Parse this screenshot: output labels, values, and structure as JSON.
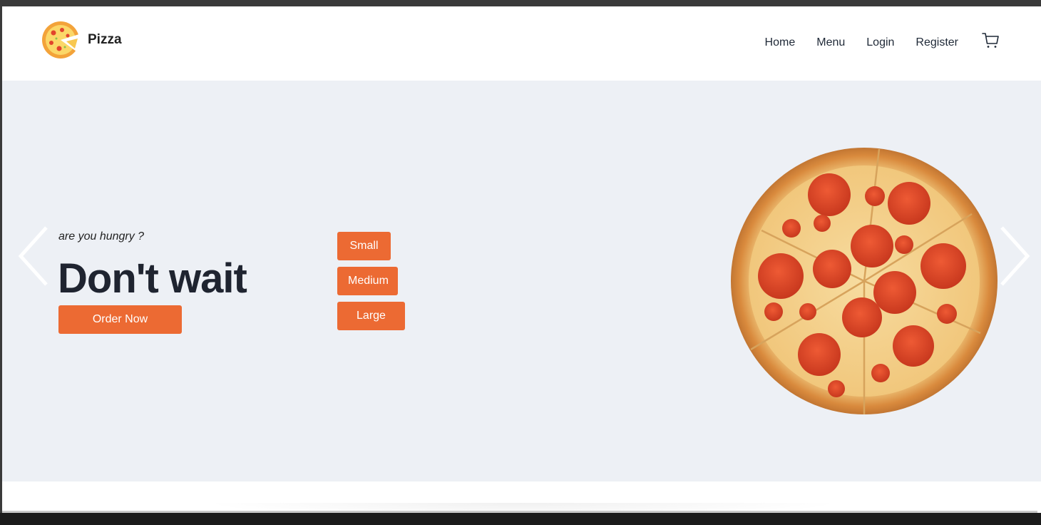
{
  "header": {
    "brand": "Pizza",
    "logo_icon": "pizza-logo-icon",
    "nav": [
      "Home",
      "Menu",
      "Login",
      "Register"
    ],
    "cart_icon": "cart-icon"
  },
  "hero": {
    "tagline": "are you hungry ?",
    "headline": "Don't wait",
    "order_label": "Order Now",
    "sizes": [
      "Small",
      "Medium",
      "Large"
    ],
    "accent_color": "#ec6a33",
    "background_color": "#edf0f5",
    "image": "pepperoni-pizza",
    "prev_icon": "chevron-left-icon",
    "next_icon": "chevron-right-icon"
  }
}
